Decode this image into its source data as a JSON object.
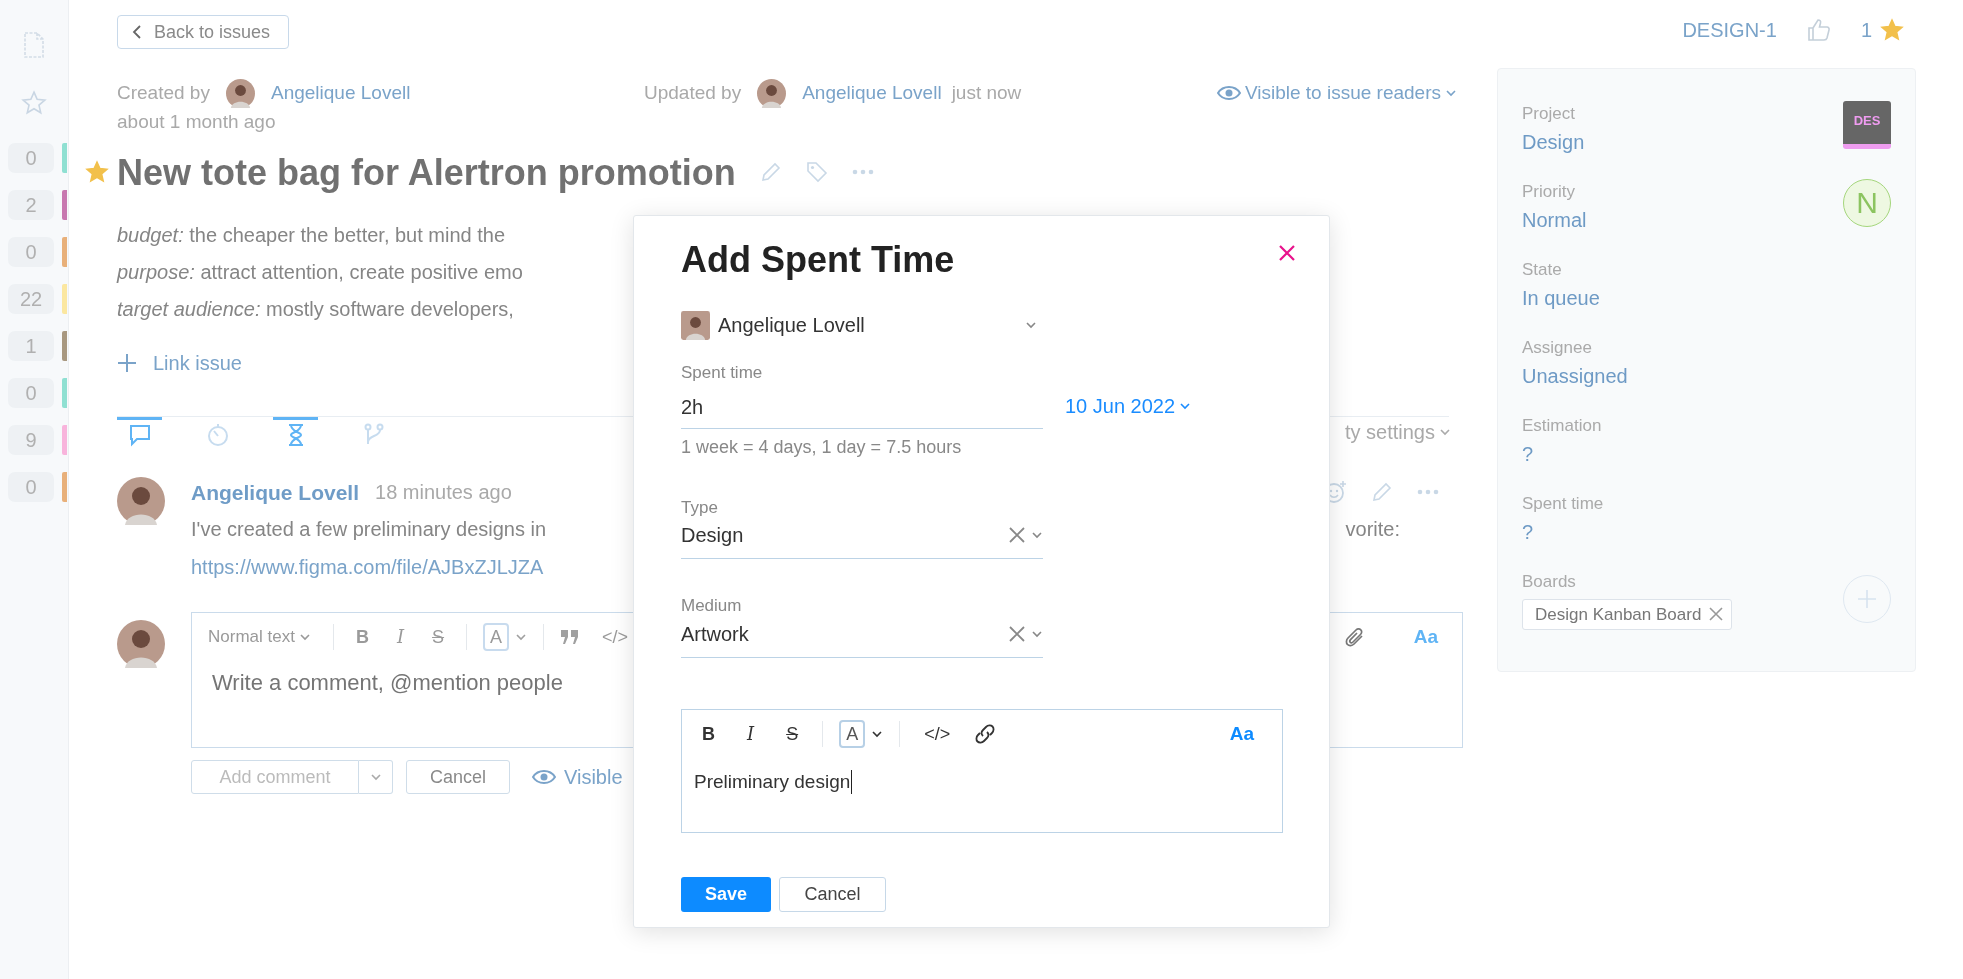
{
  "sidebar": {
    "counters": [
      {
        "count": "0",
        "color": "#8fe0d2"
      },
      {
        "count": "2",
        "color": "#c878b0"
      },
      {
        "count": "0",
        "color": "#e8b07a"
      },
      {
        "count": "22",
        "color": "#fbe7a0"
      },
      {
        "count": "1",
        "color": "#a89880"
      },
      {
        "count": "0",
        "color": "#8fe0d2"
      },
      {
        "count": "9",
        "color": "#f8b4dc"
      },
      {
        "count": "0",
        "color": "#e8b07a"
      }
    ]
  },
  "back_button": "Back to issues",
  "header": {
    "issue_id": "DESIGN-1",
    "star_count": "1"
  },
  "issue": {
    "created_label": "Created by",
    "created_by": "Angelique Lovell",
    "created_time": "about 1 month ago",
    "updated_label": "Updated by",
    "updated_by": "Angelique Lovell",
    "updated_time": "just now",
    "visibility": "Visible to issue readers",
    "starred": true,
    "title": "New tote bag for Alertron promotion",
    "description": [
      "*budget:* the cheaper the better, but mind the",
      "*purpose:* attract attention, create positive emo",
      "*target audience:* mostly software developers,"
    ],
    "link_issue": "Link issue"
  },
  "activity_tabs": [
    {
      "kind": "comments",
      "selected": true
    },
    {
      "kind": "history",
      "selected": false
    },
    {
      "kind": "spent_time",
      "selected": true
    },
    {
      "kind": "vcs",
      "selected": false
    }
  ],
  "activity_settings": "ty settings",
  "comment": {
    "author": "Angelique Lovell",
    "time": "18 minutes ago",
    "text": "I've created a few preliminary designs in",
    "text_end": "vorite:",
    "link": "https://www.figma.com/file/AJBxZJLJZA"
  },
  "comment_editor": {
    "style_menu": "Normal text",
    "toolbar": [
      {
        "kind": "bold",
        "label": "B"
      },
      {
        "kind": "italic",
        "label": "I"
      },
      {
        "kind": "strike",
        "label": "S"
      },
      {
        "kind": "color",
        "label": "A"
      },
      {
        "kind": "quote"
      },
      {
        "kind": "code",
        "label": "</>"
      }
    ],
    "format_toggle": "Aa",
    "placeholder": "Write a comment, @mention people",
    "add_button": "Add comment",
    "cancel_button": "Cancel",
    "visibility": "Visible"
  },
  "fields": [
    {
      "kind": "project",
      "label": "Project",
      "value": "Design",
      "badge": "DES"
    },
    {
      "kind": "priority",
      "label": "Priority",
      "value": "Normal",
      "badge": "N"
    },
    {
      "kind": "plain",
      "label": "State",
      "value": "In queue"
    },
    {
      "kind": "plain",
      "label": "Assignee",
      "value": "Unassigned"
    },
    {
      "kind": "plain",
      "label": "Estimation",
      "value": "?"
    },
    {
      "kind": "plain",
      "label": "Spent time",
      "value": "?"
    }
  ],
  "boards": {
    "label": "Boards",
    "tags": [
      "Design Kanban Board"
    ]
  },
  "modal": {
    "title": "Add Spent Time",
    "user": "Angelique Lovell",
    "spent_label": "Spent time",
    "spent_value": "2h",
    "date": "10 Jun 2022",
    "hint": "1 week = 4 days, 1 day = 7.5 hours",
    "selects": [
      {
        "label": "Type",
        "value": "Design"
      },
      {
        "label": "Medium",
        "value": "Artwork"
      }
    ],
    "toolbar": [
      {
        "kind": "bold",
        "label": "B"
      },
      {
        "kind": "italic",
        "label": "I"
      },
      {
        "kind": "strike",
        "label": "S"
      },
      {
        "kind": "color",
        "label": "A"
      },
      {
        "kind": "code",
        "label": "</>"
      },
      {
        "kind": "link"
      }
    ],
    "format_toggle": "Aa",
    "text": "Preliminary design",
    "save_button": "Save",
    "cancel_button": "Cancel"
  }
}
